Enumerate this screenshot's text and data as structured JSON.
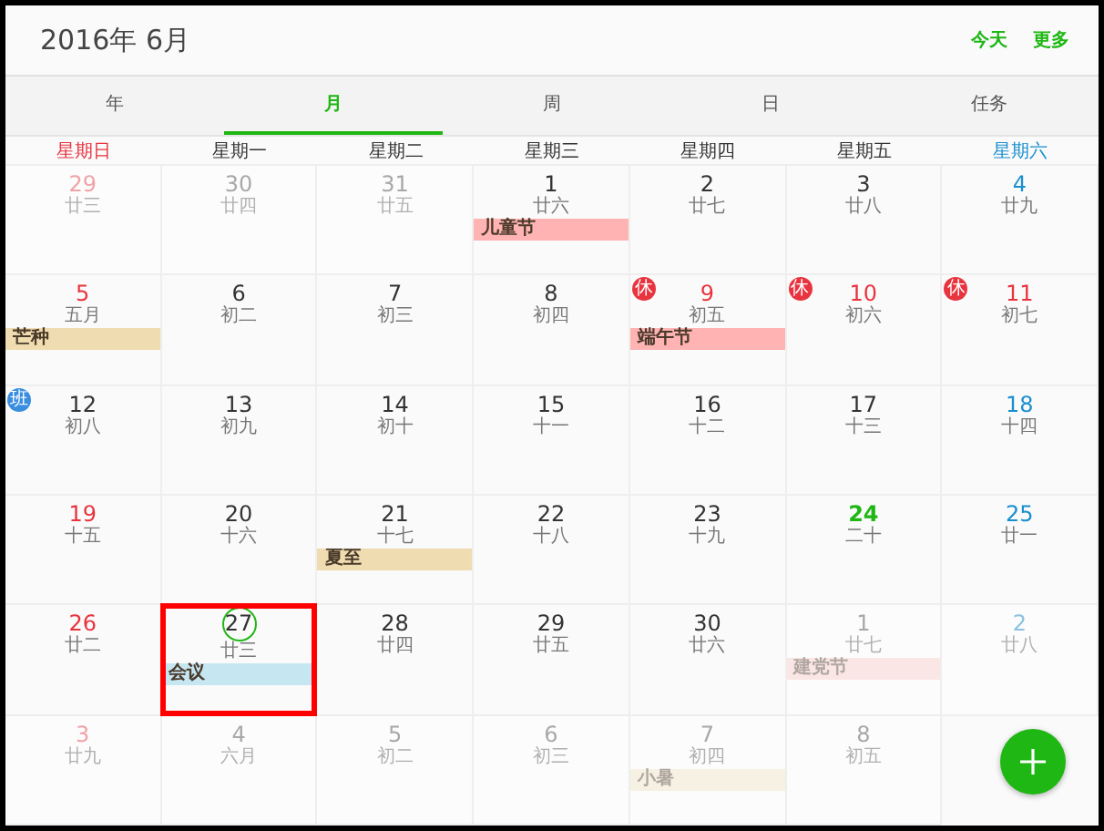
{
  "header": {
    "title": "2016年 6月",
    "actions": [
      "今天",
      "更多"
    ]
  },
  "tabs": [
    {
      "label": "年",
      "selected": false
    },
    {
      "label": "月",
      "selected": true
    },
    {
      "label": "周",
      "selected": false
    },
    {
      "label": "日",
      "selected": false
    },
    {
      "label": "任务",
      "selected": false
    }
  ],
  "weekdays": [
    {
      "label": "星期日",
      "color": "#e8343f"
    },
    {
      "label": "星期一",
      "color": "#333333"
    },
    {
      "label": "星期二",
      "color": "#333333"
    },
    {
      "label": "星期三",
      "color": "#333333"
    },
    {
      "label": "星期四",
      "color": "#333333"
    },
    {
      "label": "星期五",
      "color": "#333333"
    },
    {
      "label": "星期六",
      "color": "#1a8fd0"
    }
  ],
  "weeks": [
    [
      {
        "day": "29",
        "lunar": "廿三",
        "color": "#f0a3a8",
        "in_month": false,
        "selected": false
      },
      {
        "day": "30",
        "lunar": "廿四",
        "color": "#a8a8a8",
        "in_month": false,
        "selected": false
      },
      {
        "day": "31",
        "lunar": "廿五",
        "color": "#a8a8a8",
        "in_month": false,
        "selected": false
      },
      {
        "day": "1",
        "lunar": "廿六",
        "color": "#333333",
        "in_month": true,
        "selected": false,
        "events": [
          {
            "label": "儿童节",
            "color": "#ffb3b3"
          }
        ]
      },
      {
        "day": "2",
        "lunar": "廿七",
        "color": "#333333",
        "in_month": true,
        "selected": false
      },
      {
        "day": "3",
        "lunar": "廿八",
        "color": "#333333",
        "in_month": true,
        "selected": false
      },
      {
        "day": "4",
        "lunar": "廿九",
        "color": "#1a8fd0",
        "in_month": true,
        "selected": false
      }
    ],
    [
      {
        "day": "5",
        "lunar": "五月",
        "color": "#e8343f",
        "in_month": true,
        "selected": false,
        "events": [
          {
            "label": "芒种",
            "color": "#efdcb0"
          }
        ]
      },
      {
        "day": "6",
        "lunar": "初二",
        "color": "#333333",
        "in_month": true,
        "selected": false
      },
      {
        "day": "7",
        "lunar": "初三",
        "color": "#333333",
        "in_month": true,
        "selected": false
      },
      {
        "day": "8",
        "lunar": "初四",
        "color": "#333333",
        "in_month": true,
        "selected": false
      },
      {
        "day": "9",
        "lunar": "初五",
        "color": "#e8343f",
        "in_month": true,
        "selected": false,
        "badge": {
          "text": "休",
          "color": "#e8343f"
        },
        "events": [
          {
            "label": "端午节",
            "color": "#ffb3b3"
          }
        ]
      },
      {
        "day": "10",
        "lunar": "初六",
        "color": "#e8343f",
        "in_month": true,
        "selected": false,
        "badge": {
          "text": "休",
          "color": "#e8343f"
        }
      },
      {
        "day": "11",
        "lunar": "初七",
        "color": "#e8343f",
        "in_month": true,
        "selected": false,
        "badge": {
          "text": "休",
          "color": "#e8343f"
        }
      }
    ],
    [
      {
        "day": "12",
        "lunar": "初八",
        "color": "#333333",
        "in_month": true,
        "selected": false,
        "badge": {
          "text": "班",
          "color": "#3a8ee0"
        }
      },
      {
        "day": "13",
        "lunar": "初九",
        "color": "#333333",
        "in_month": true,
        "selected": false
      },
      {
        "day": "14",
        "lunar": "初十",
        "color": "#333333",
        "in_month": true,
        "selected": false
      },
      {
        "day": "15",
        "lunar": "十一",
        "color": "#333333",
        "in_month": true,
        "selected": false
      },
      {
        "day": "16",
        "lunar": "十二",
        "color": "#333333",
        "in_month": true,
        "selected": false
      },
      {
        "day": "17",
        "lunar": "十三",
        "color": "#333333",
        "in_month": true,
        "selected": false
      },
      {
        "day": "18",
        "lunar": "十四",
        "color": "#1a8fd0",
        "in_month": true,
        "selected": false
      }
    ],
    [
      {
        "day": "19",
        "lunar": "十五",
        "color": "#e8343f",
        "in_month": true,
        "selected": false
      },
      {
        "day": "20",
        "lunar": "十六",
        "color": "#333333",
        "in_month": true,
        "selected": false
      },
      {
        "day": "21",
        "lunar": "十七",
        "color": "#333333",
        "in_month": true,
        "selected": false,
        "events": [
          {
            "label": "夏至",
            "color": "#efdcb0"
          }
        ]
      },
      {
        "day": "22",
        "lunar": "十八",
        "color": "#333333",
        "in_month": true,
        "selected": false
      },
      {
        "day": "23",
        "lunar": "十九",
        "color": "#333333",
        "in_month": true,
        "selected": false
      },
      {
        "day": "24",
        "lunar": "二十",
        "color": "#1fb714",
        "in_month": true,
        "selected": false,
        "today": true
      },
      {
        "day": "25",
        "lunar": "廿一",
        "color": "#1a8fd0",
        "in_month": true,
        "selected": false
      }
    ],
    [
      {
        "day": "26",
        "lunar": "廿二",
        "color": "#e8343f",
        "in_month": true,
        "selected": false
      },
      {
        "day": "27",
        "lunar": "廿三",
        "color": "#333333",
        "in_month": true,
        "selected": true,
        "events": [
          {
            "label": "会议",
            "color": "#c6e6f2"
          }
        ]
      },
      {
        "day": "28",
        "lunar": "廿四",
        "color": "#333333",
        "in_month": true,
        "selected": false
      },
      {
        "day": "29",
        "lunar": "廿五",
        "color": "#333333",
        "in_month": true,
        "selected": false
      },
      {
        "day": "30",
        "lunar": "廿六",
        "color": "#333333",
        "in_month": true,
        "selected": false
      },
      {
        "day": "1",
        "lunar": "廿七",
        "color": "#a8a8a8",
        "in_month": false,
        "selected": false,
        "events": [
          {
            "label": "建党节",
            "color": "#fbe6e6"
          }
        ]
      },
      {
        "day": "2",
        "lunar": "廿八",
        "color": "#8cc3e3",
        "in_month": false,
        "selected": false
      }
    ],
    [
      {
        "day": "3",
        "lunar": "廿九",
        "color": "#f0a3a8",
        "in_month": false,
        "selected": false
      },
      {
        "day": "4",
        "lunar": "六月",
        "color": "#a8a8a8",
        "in_month": false,
        "selected": false
      },
      {
        "day": "5",
        "lunar": "初二",
        "color": "#a8a8a8",
        "in_month": false,
        "selected": false
      },
      {
        "day": "6",
        "lunar": "初三",
        "color": "#a8a8a8",
        "in_month": false,
        "selected": false
      },
      {
        "day": "7",
        "lunar": "初四",
        "color": "#a8a8a8",
        "in_month": false,
        "selected": false,
        "events": [
          {
            "label": "小暑",
            "color": "#f6f1e2"
          }
        ]
      },
      {
        "day": "8",
        "lunar": "初五",
        "color": "#a8a8a8",
        "in_month": false,
        "selected": false
      }
    ]
  ]
}
